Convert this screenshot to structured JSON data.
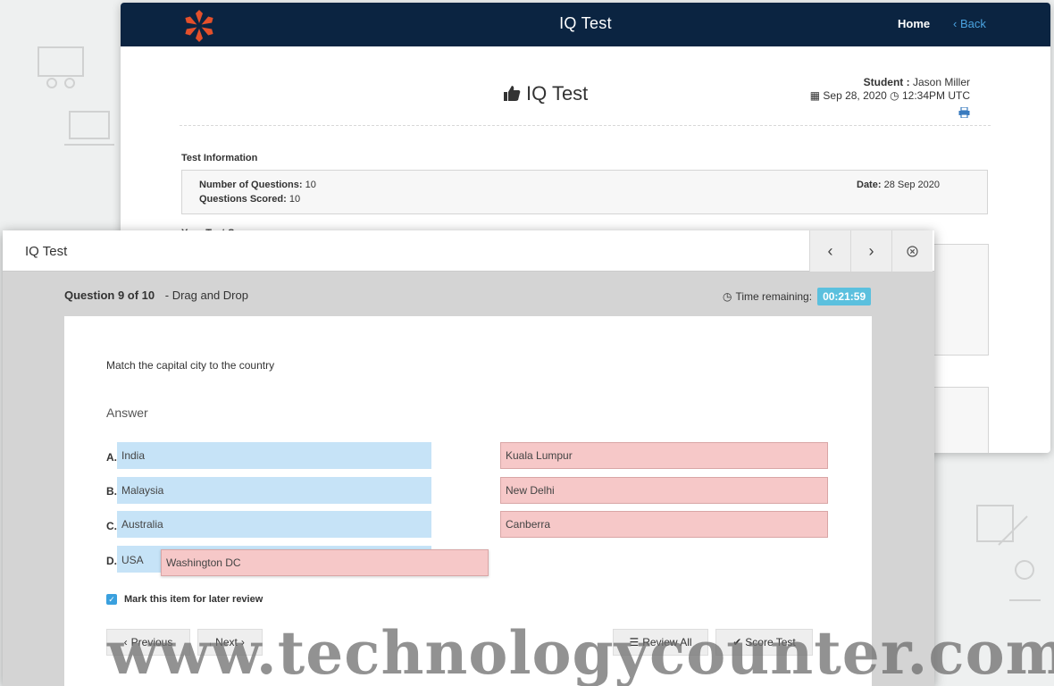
{
  "background_window": {
    "app_title": "IQ Test",
    "nav": {
      "home": "Home",
      "back": "Back"
    },
    "report": {
      "title": "IQ Test",
      "student_label": "Student :",
      "student_name": "Jason Miller",
      "date": "Sep 28, 2020",
      "time": "12:34PM UTC"
    },
    "test_info": {
      "section_title": "Test Information",
      "num_questions_label": "Number of Questions:",
      "num_questions": "10",
      "questions_scored_label": "Questions Scored:",
      "questions_scored": "10",
      "date_label": "Date:",
      "date": "28 Sep 2020"
    },
    "score_section_title": "Your Test Score"
  },
  "modal": {
    "title": "IQ Test",
    "question_label": "Question 9 of 10",
    "question_type": "- Drag and Drop",
    "time_remaining_label": "Time remaining:",
    "time_remaining": "00:21:59",
    "prompt": "Match the capital city to the country",
    "answer_label": "Answer",
    "sources": [
      {
        "letter": "A.",
        "text": "India"
      },
      {
        "letter": "B.",
        "text": "Malaysia"
      },
      {
        "letter": "C.",
        "text": "Australia"
      },
      {
        "letter": "D.",
        "text": "USA"
      }
    ],
    "targets": [
      "Kuala Lumpur",
      "New Delhi",
      "Canberra"
    ],
    "dragged_item": "Washington DC",
    "mark_review_label": "Mark this item for later review",
    "mark_review_checked": true,
    "buttons": {
      "previous": "Previous",
      "next": "Next",
      "review_all": "Review All",
      "score_test": "Score Test"
    }
  },
  "watermark": "www.technologycounter.com",
  "colors": {
    "header_bg": "#0b2441",
    "accent_blue": "#4aa3e0",
    "timer_badge": "#5bc0de",
    "source_bg": "#c6e3f7",
    "target_bg": "#f6c8c8"
  }
}
